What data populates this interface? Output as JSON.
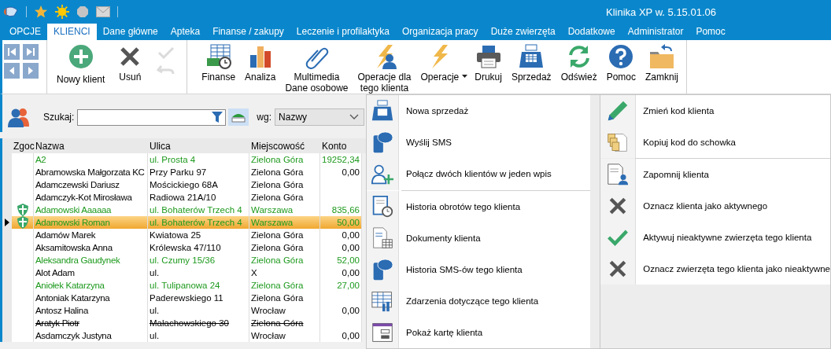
{
  "window": {
    "title": "Klinika XP w. 5.15.01.06"
  },
  "tabs": [
    {
      "label": "OPCJE",
      "selected": false
    },
    {
      "label": "KLIENCI",
      "selected": true
    },
    {
      "label": "Dane główne",
      "selected": false
    },
    {
      "label": "Apteka",
      "selected": false
    },
    {
      "label": "Finanse / zakupy",
      "selected": false
    },
    {
      "label": "Leczenie i profilaktyka",
      "selected": false
    },
    {
      "label": "Organizacja pracy",
      "selected": false
    },
    {
      "label": "Duże zwierzęta",
      "selected": false
    },
    {
      "label": "Dodatkowe",
      "selected": false
    },
    {
      "label": "Administrator",
      "selected": false
    },
    {
      "label": "Pomoc",
      "selected": false
    }
  ],
  "ribbon_groups": [
    {
      "buttons": [
        {
          "label": "Nowy klient",
          "disabled": false
        },
        {
          "label": "Usuń",
          "disabled": false
        },
        {
          "kind": "stack",
          "disabled": true
        }
      ]
    },
    {
      "buttons": [
        {
          "label": "Finanse",
          "disabled": false
        },
        {
          "label": "Analiza",
          "disabled": false
        },
        {
          "label": "Multimedia\nDane osobowe",
          "disabled": false
        },
        {
          "label": "Operacje dla\ntego klienta",
          "disabled": false
        },
        {
          "label": "Operacje",
          "disabled": false,
          "dropdown": true
        },
        {
          "label": "Drukuj",
          "disabled": false
        },
        {
          "label": "Sprzedaż",
          "disabled": false
        },
        {
          "label": "Odśwież",
          "disabled": false
        },
        {
          "label": "Pomoc",
          "disabled": false
        },
        {
          "label": "Zamknij",
          "disabled": false
        }
      ]
    }
  ],
  "search": {
    "label": "Szukaj:",
    "by_label": "wg:",
    "by_value": "Nazwy"
  },
  "table": {
    "columns": [
      "Zgoc",
      "Nazwa",
      "Ulica",
      "Miejscowość",
      "Konto"
    ],
    "rows": [
      {
        "cells": [
          "",
          "A2",
          "ul. Prosta 4",
          "Zielona Góra",
          "19252,34"
        ],
        "kind": "green",
        "shield": false,
        "selected": false
      },
      {
        "cells": [
          "",
          "Abramowska Małgorzata KC",
          "Przy Parku 97",
          "Zielona Góra",
          "0,00"
        ],
        "kind": "normal",
        "shield": false,
        "selected": false
      },
      {
        "cells": [
          "",
          "Adamczewski Dariusz",
          "Mościckiego 68A",
          "Zielona Góra",
          ""
        ],
        "kind": "normal",
        "shield": false,
        "selected": false
      },
      {
        "cells": [
          "",
          "Adamczyk-Kot Mirosława",
          "Radiowa 21A/10",
          "Zielona Góra",
          ""
        ],
        "kind": "normal",
        "shield": false,
        "selected": false
      },
      {
        "cells": [
          "",
          "Adamowski Aaaaaa",
          "ul. Bohaterów Trzech 4",
          "Warszawa",
          "835,66"
        ],
        "kind": "green",
        "shield": true,
        "selected": false
      },
      {
        "cells": [
          "",
          "Adamowski Roman",
          "ul. Bohaterów Trzech 4",
          "Warszawa",
          "50,00"
        ],
        "kind": "green",
        "shield": true,
        "selected": true
      },
      {
        "cells": [
          "",
          "Adamów Marek",
          "Kwiatowa 25",
          "Zielona Góra",
          "0,00"
        ],
        "kind": "normal",
        "shield": false,
        "selected": false
      },
      {
        "cells": [
          "",
          "Aksamitowska Anna",
          "Królewska 47/110",
          "Zielona Góra",
          "0,00"
        ],
        "kind": "normal",
        "shield": false,
        "selected": false
      },
      {
        "cells": [
          "",
          "Aleksandra Gaudynek",
          "ul. Czumy 15/36",
          "Zielona Góra",
          "52,00"
        ],
        "kind": "green",
        "shield": false,
        "selected": false
      },
      {
        "cells": [
          "",
          "Alot  Adam",
          "ul.",
          "X",
          "0,00"
        ],
        "kind": "normal",
        "shield": false,
        "selected": false
      },
      {
        "cells": [
          "",
          "Aniołek Katarzyna",
          "ul. Tulipanowa 24",
          "Zielona Góra",
          "27,00"
        ],
        "kind": "green",
        "shield": false,
        "selected": false
      },
      {
        "cells": [
          "",
          "Antoniak Katarzyna",
          "Paderewskiego 11",
          "Zielona Góra",
          ""
        ],
        "kind": "normal",
        "shield": false,
        "selected": false
      },
      {
        "cells": [
          "",
          "Antosz Halina",
          "ul.",
          " Wrocław",
          "0,00"
        ],
        "kind": "normal",
        "shield": false,
        "selected": false
      },
      {
        "cells": [
          "",
          "Aratyk Piotr",
          "Małachowskiego 30",
          "Zielona Góra",
          ""
        ],
        "kind": "inactive",
        "shield": false,
        "selected": false
      },
      {
        "cells": [
          "",
          "Asdamczyk  Justyna",
          "ul.",
          " Wrocław",
          "0,00"
        ],
        "kind": "normal",
        "shield": false,
        "selected": false
      }
    ]
  },
  "context_menu": {
    "columns": [
      {
        "sections": [
          {
            "items": [
              "Nowa sprzedaż",
              "Wyślij SMS",
              "Połącz dwóch klientów w jeden wpis"
            ]
          },
          {
            "items": [
              "Historia obrotów tego klienta",
              "Dokumenty klienta",
              "Historia SMS-ów tego klienta",
              "Zdarzenia dotyczące tego klienta",
              "Pokaż kartę klienta"
            ]
          }
        ]
      },
      {
        "sections": [
          {
            "items": [
              "Zmień kod klienta",
              "Kopiuj kod do schowka"
            ]
          },
          {
            "items": [
              "Zapomnij klienta",
              "Oznacz klienta jako aktywnego",
              "Aktywuj nieaktywne zwierzęta tego klienta",
              "Oznacz zwierzęta tego klienta jako nieaktywne"
            ]
          }
        ]
      }
    ]
  }
}
